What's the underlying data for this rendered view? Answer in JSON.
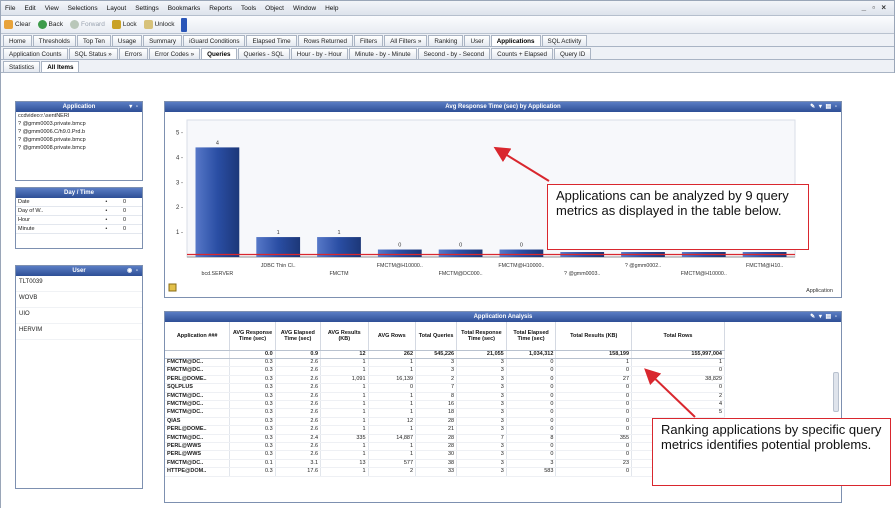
{
  "menu": [
    "File",
    "Edit",
    "View",
    "Selections",
    "Layout",
    "Settings",
    "Bookmarks",
    "Reports",
    "Tools",
    "Object",
    "Window",
    "Help"
  ],
  "window_controls": "_ ▫ ×",
  "toolbar": {
    "clear": "Clear",
    "back": "Back",
    "forward": "Forward",
    "lock": "Lock",
    "unlock": "Unlock"
  },
  "tabs_row1": [
    {
      "label": "Home",
      "active": false
    },
    {
      "label": "Thresholds",
      "active": false
    },
    {
      "label": "Top Ten",
      "active": false
    },
    {
      "label": "Usage",
      "active": false
    },
    {
      "label": "Summary",
      "active": false
    },
    {
      "label": "iGuard Conditions",
      "active": false
    },
    {
      "label": "Elapsed Time",
      "active": false
    },
    {
      "label": "Rows Returned",
      "active": false
    },
    {
      "label": "Filters",
      "active": false
    },
    {
      "label": "All Filters »",
      "active": false
    },
    {
      "label": "Ranking",
      "active": false
    },
    {
      "label": "User",
      "active": false
    },
    {
      "label": "Applications",
      "active": true
    },
    {
      "label": "SQL Activity",
      "active": false
    }
  ],
  "tabs_row2": [
    {
      "label": "Application Counts",
      "active": false
    },
    {
      "label": "SQL Status »",
      "active": false
    },
    {
      "label": "Errors",
      "active": false
    },
    {
      "label": "Error Codes »",
      "active": false
    },
    {
      "label": "Queries",
      "active": true
    },
    {
      "label": "Queries - SQL",
      "active": false
    },
    {
      "label": "Hour - by - Hour",
      "active": false
    },
    {
      "label": "Minute - by - Minute",
      "active": false
    },
    {
      "label": "Second - by - Second",
      "active": false
    },
    {
      "label": "Counts + Elapsed",
      "active": false
    },
    {
      "label": "Query ID",
      "active": false
    }
  ],
  "tabs_row3": [
    {
      "label": "Statistics",
      "active": false
    },
    {
      "label": "All Items",
      "active": true
    }
  ],
  "listbox_apps": {
    "title": "Application",
    "items": [
      "ccdvideo:r.\\sentNERI",
      "? @gmm0003.private.bmcp",
      "? @gmm0006.C/h9.0.Prd.b",
      "? @gmm0008.private.bmcp",
      "? @gmm0008.private.bmcp"
    ]
  },
  "listbox_time": {
    "title": "Day / Time",
    "rows": [
      {
        "label": "Date",
        "mark": "•",
        "value": "0"
      },
      {
        "label": "Day of W..",
        "mark": "•",
        "value": "0"
      },
      {
        "label": "Hour",
        "mark": "•",
        "value": "0"
      },
      {
        "label": "Minute",
        "mark": "•",
        "value": "0"
      }
    ]
  },
  "listbox_users": {
    "title": "User",
    "items": [
      "TLT0039",
      "WOVB",
      "UIO",
      "HERVIM"
    ]
  },
  "chart_data": {
    "type": "bar",
    "title": "Avg Response Time (sec) by Application",
    "categories": [
      "bcd.SERVER",
      "JDBC Thin Cl..",
      "FMCTM",
      "FMCTM@H10000..",
      "FMCTM@DC000..",
      "FMCTM@H10000..",
      "? @gmm0003..",
      "? @gmm0002..",
      "FMCTM@H10000..",
      "FMCTM@H10.."
    ],
    "values": [
      4.4,
      0.8,
      0.8,
      0.3,
      0.3,
      0.3,
      0.2,
      0.2,
      0.2,
      0.2
    ],
    "data_labels": [
      "4",
      "1",
      "1",
      "0",
      "0",
      "0",
      "0",
      "0",
      "0",
      "0"
    ],
    "ylim": [
      0,
      5.5
    ],
    "yticks": [
      "1 -",
      "2 -",
      "3 -",
      "4 -",
      "5 -"
    ],
    "reference_line": 0.1,
    "footer": "Application",
    "colors": {
      "bar": "#2a4ea4",
      "ref_line": "#d9272e"
    }
  },
  "table": {
    "title": "Application Analysis",
    "headers": [
      "Application ###",
      "AVG Response Time (sec)",
      "AVG Elapsed Time (sec)",
      "AVG Results (KB)",
      "AVG Rows",
      "Total Queries",
      "Total Response Time (sec)",
      "Total Elapsed Time (sec)",
      "Total Results (KB)",
      "Total Rows"
    ],
    "totals": [
      "",
      "0.0",
      "0.9",
      "12",
      "262",
      "545,226",
      "21,055",
      "1,034,312",
      "158,199",
      "155,997,004"
    ],
    "rows": [
      [
        "FMCTM@DC..",
        "0.3",
        "2.6",
        "1",
        "1",
        "3",
        "3",
        "0",
        "1",
        "1"
      ],
      [
        "FMCTM@DC..",
        "0.3",
        "2.6",
        "1",
        "1",
        "3",
        "3",
        "0",
        "0",
        "0"
      ],
      [
        "PERL@DOME..",
        "0.3",
        "2.6",
        "1,091",
        "16,139",
        "2",
        "3",
        "0",
        "27",
        "38,829"
      ],
      [
        "SQLPLUS",
        "0.3",
        "2.6",
        "1",
        "0",
        "7",
        "3",
        "0",
        "0",
        "0"
      ],
      [
        "FMCTM@DC..",
        "0.3",
        "2.6",
        "1",
        "1",
        "8",
        "3",
        "0",
        "0",
        "2"
      ],
      [
        "FMCTM@DC..",
        "0.3",
        "2.6",
        "1",
        "1",
        "16",
        "3",
        "0",
        "0",
        "4"
      ],
      [
        "FMCTM@DC..",
        "0.3",
        "2.6",
        "1",
        "1",
        "18",
        "3",
        "0",
        "0",
        "5"
      ],
      [
        "QIAS",
        "0.3",
        "2.6",
        "1",
        "12",
        "28",
        "3",
        "0",
        "0",
        "0"
      ],
      [
        "PERL@DOME..",
        "0.3",
        "2.6",
        "1",
        "1",
        "21",
        "3",
        "0",
        "0",
        "1"
      ],
      [
        "FMCTM@DC..",
        "0.3",
        "2.4",
        "335",
        "14,887",
        "28",
        "7",
        "8",
        "355",
        "2"
      ],
      [
        "PERL@WWS",
        "0.3",
        "2.6",
        "1",
        "1",
        "28",
        "3",
        "0",
        "0",
        "0"
      ],
      [
        "PERL@WWS",
        "0.3",
        "2.6",
        "1",
        "1",
        "30",
        "3",
        "0",
        "0",
        "0"
      ],
      [
        "FMCTM@DC..",
        "0.1",
        "3.1",
        "13",
        "577",
        "38",
        "3",
        "3",
        "23",
        "0"
      ],
      [
        "HTTPE@DOM..",
        "0.3",
        "17.6",
        "1",
        "2",
        "33",
        "3",
        "583",
        "0",
        "62"
      ]
    ]
  },
  "callouts": {
    "top": "Applications can be analyzed by 9 query metrics as displayed in the table below.",
    "bottom": "Ranking applications by specific query metrics identifies potential problems."
  }
}
